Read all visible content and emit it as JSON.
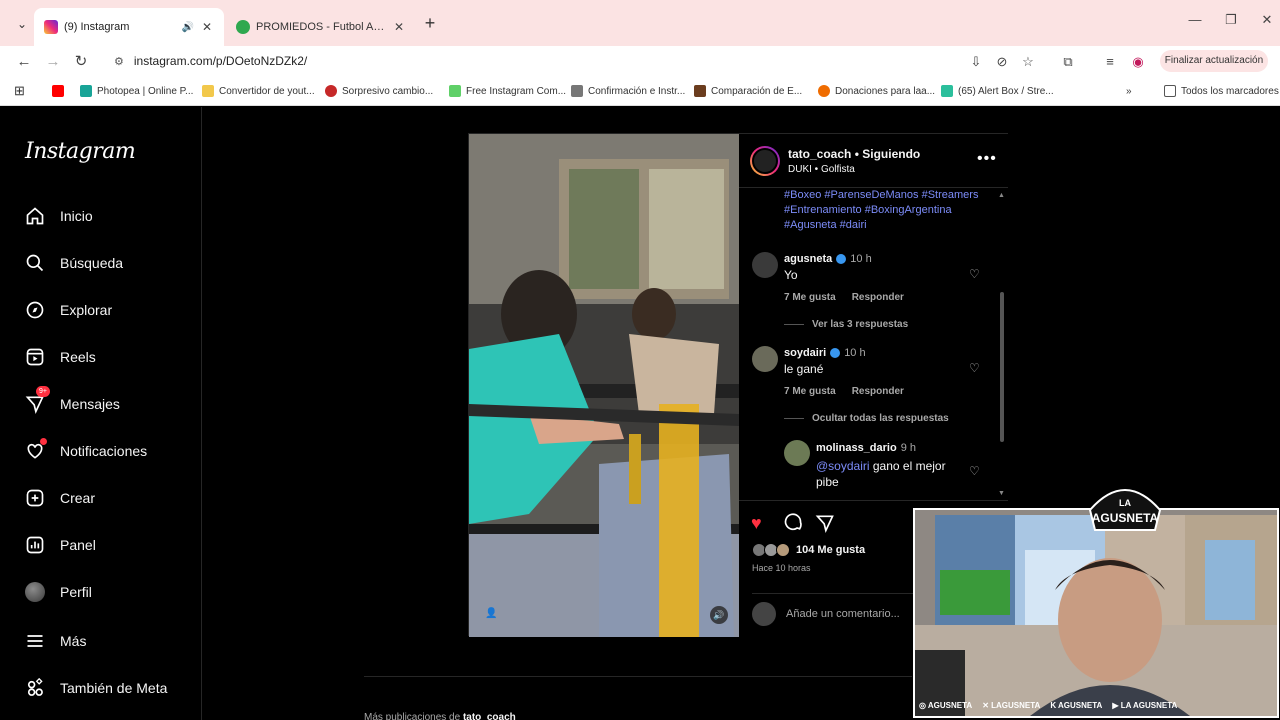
{
  "browser": {
    "tabs": [
      {
        "title": "(9) Instagram",
        "active": true
      },
      {
        "title": "PROMIEDOS - Futbol Argentino",
        "active": false
      }
    ],
    "url": "instagram.com/p/DOetoNzDZk2/",
    "update_button": "Finalizar actualización",
    "bookmarks": [
      "Photopea | Online P...",
      "Convertidor de yout...",
      "Sorpresivo cambio...",
      "Free Instagram Com...",
      "Confirmación e Instr...",
      "Comparación de E...",
      "Donaciones para laa...",
      "(65) Alert Box / Stre..."
    ],
    "all_bookmarks": "Todos los marcadores"
  },
  "sidebar": {
    "logo": "Instagram",
    "items": [
      {
        "label": "Inicio",
        "icon": "home-icon"
      },
      {
        "label": "Búsqueda",
        "icon": "search-icon"
      },
      {
        "label": "Explorar",
        "icon": "compass-icon"
      },
      {
        "label": "Reels",
        "icon": "reels-icon"
      },
      {
        "label": "Mensajes",
        "icon": "messages-icon",
        "badge": "9+"
      },
      {
        "label": "Notificaciones",
        "icon": "heart-icon"
      },
      {
        "label": "Crear",
        "icon": "plus-icon"
      },
      {
        "label": "Panel",
        "icon": "dashboard-icon"
      },
      {
        "label": "Perfil",
        "icon": "avatar"
      },
      {
        "label": "Más",
        "icon": "menu-icon"
      },
      {
        "label": "También de Meta",
        "icon": "meta-icon"
      }
    ]
  },
  "post": {
    "username": "tato_coach",
    "following": "Siguiendo",
    "song": "DUKI • Golfista",
    "hashtags": "#Boxeo #ParenseDeManos #Streamers #Entrenamiento #BoxingArgentina #Agusneta #dairi",
    "comments": [
      {
        "user": "agusneta",
        "time": "10 h",
        "text": "Yo",
        "likes": "7 Me gusta",
        "reply": "Responder",
        "thread": "Ver las 3 respuestas"
      },
      {
        "user": "soydairi",
        "time": "10 h",
        "text": "le gané",
        "likes": "7 Me gusta",
        "reply": "Responder",
        "thread": "Ocultar todas las respuestas"
      }
    ],
    "reply": {
      "user": "molinass_dario",
      "time": "9 h",
      "mention": "@soydairi",
      "text": " gano el mejor pibe"
    },
    "like_count": "104 Me gusta",
    "posted": "Hace 10 horas",
    "add_comment": "Añade un comentario..."
  },
  "more_posts": {
    "prefix": "Más publicaciones de",
    "user": "tato_coach"
  },
  "overlay": {
    "logo_text": "LA AGUSNETA",
    "socials": [
      "AGUSNETA",
      "LAGUSNETA",
      "AGUSNETA",
      "LA AGUSNETA"
    ]
  }
}
